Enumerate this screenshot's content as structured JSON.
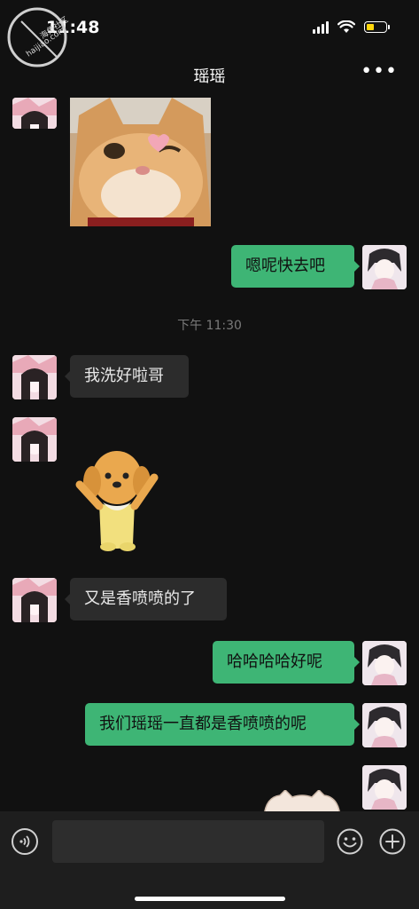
{
  "status_bar": {
    "time": "11:48",
    "battery_color": "#ffd60a"
  },
  "watermark": {
    "line1": "海角社区",
    "line2": "haijiao.com"
  },
  "header": {
    "title": "瑶瑶",
    "more_icon": "more-dots-icon",
    "more_label": "•••"
  },
  "messages": [
    {
      "type": "image",
      "direction": "in",
      "content": "cat-heart-sticker"
    },
    {
      "type": "text",
      "direction": "out",
      "text": "嗯呢快去吧"
    },
    {
      "type": "timestamp",
      "text": "下午 11:30"
    },
    {
      "type": "text",
      "direction": "in",
      "text": "我洗好啦哥"
    },
    {
      "type": "image",
      "direction": "in",
      "content": "puppy-sticker"
    },
    {
      "type": "text",
      "direction": "in",
      "text": "又是香喷喷的了"
    },
    {
      "type": "text",
      "direction": "out",
      "text": "哈哈哈哈好呢"
    },
    {
      "type": "text",
      "direction": "out",
      "text": "我们瑶瑶一直都是香喷喷的呢"
    },
    {
      "type": "image",
      "direction": "out",
      "content": "partial-sticker"
    }
  ],
  "input_bar": {
    "voice_icon": "voice-icon",
    "emoji_icon": "emoji-icon",
    "plus_icon": "plus-icon"
  },
  "colors": {
    "background": "#111111",
    "outgoing_bubble": "#3eb575",
    "incoming_bubble": "#2c2c2c"
  }
}
